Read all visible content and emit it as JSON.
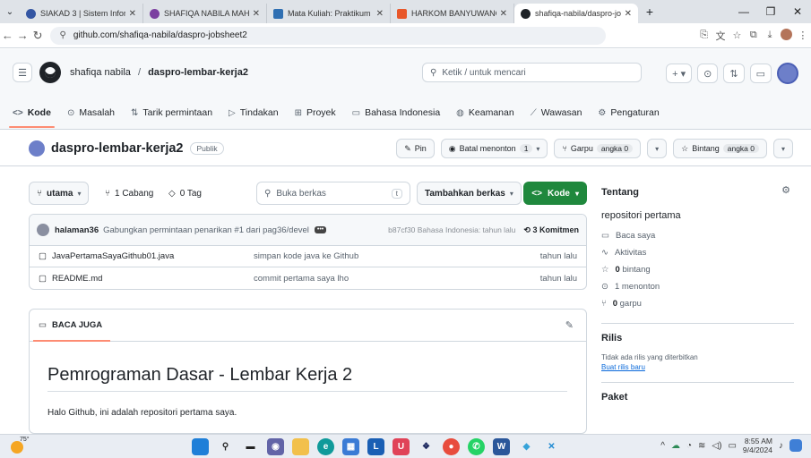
{
  "browser": {
    "tabs": [
      {
        "title": "SIAKAD 3 | Sistem Inform",
        "color": "#3456a3"
      },
      {
        "title": "SHAFIQA NABILA MAHA",
        "color": "#7b3fa0"
      },
      {
        "title": "Mata Kuliah: Praktikum D",
        "color": "#2f6fb2"
      },
      {
        "title": "HARKOM BANYUWANGI",
        "color": "#e8572a"
      },
      {
        "title": "shafiqa-nabila/daspro-jo",
        "color": "#1f2328"
      }
    ],
    "url": "github.com/shafiqa-nabila/daspro-jobsheet2",
    "new_tab": "+"
  },
  "header": {
    "owner": "shafiqa nabila",
    "separator": "/",
    "repo": "daspro-lembar-kerja2",
    "search_placeholder": "Ketik / untuk mencari"
  },
  "nav": [
    {
      "icon": "<>",
      "label": "Kode"
    },
    {
      "icon": "⊙",
      "label": "Masalah"
    },
    {
      "icon": "⇅",
      "label": "Tarik permintaan"
    },
    {
      "icon": "▷",
      "label": "Tindakan"
    },
    {
      "icon": "⊞",
      "label": "Proyek"
    },
    {
      "icon": "▭",
      "label": "Bahasa Indonesia"
    },
    {
      "icon": "◍",
      "label": "Keamanan"
    },
    {
      "icon": "⟋",
      "label": "Wawasan"
    },
    {
      "icon": "⚙",
      "label": "Pengaturan"
    }
  ],
  "repo": {
    "name": "daspro-lembar-kerja2",
    "visibility": "Publik",
    "pin": "Pin",
    "watch": "Batal menonton",
    "watch_count": "1",
    "fork": "Garpu",
    "fork_count": "angka 0",
    "star": "Bintang",
    "star_count": "angka 0"
  },
  "toolbar": {
    "branch": "utama",
    "branches": "1 Cabang",
    "tags": "0 Tag",
    "file_search": "Buka berkas",
    "file_search_key": "t",
    "add_file": "Tambahkan berkas",
    "code": "Kode"
  },
  "commit": {
    "user": "halaman36",
    "message": "Gabungkan permintaan penarikan #1 dari pag36/devel",
    "dots": "•••",
    "meta": "b87cf30 Bahasa Indonesia: tahun lalu",
    "count": "3 Komitmen"
  },
  "files": [
    {
      "name": "JavaPertamaSayaGithub01.java",
      "message": "simpan kode java ke Github",
      "time": "tahun lalu"
    },
    {
      "name": "README.md",
      "message": "commit pertama saya lho",
      "time": "tahun lalu"
    }
  ],
  "readme": {
    "tab": "BACA JUGA",
    "heading": "Pemrograman Dasar - Lembar Kerja 2",
    "paragraph": "Halo Github, ini adalah repositori pertama saya."
  },
  "sidebar": {
    "about_title": "Tentang",
    "description": "repositori pertama",
    "items": [
      {
        "icon": "▭",
        "text": "Baca saya",
        "bold": ""
      },
      {
        "icon": "∿",
        "text": "Aktivitas",
        "bold": ""
      },
      {
        "icon": "☆",
        "text": " bintang",
        "bold": "0"
      },
      {
        "icon": "⊙",
        "text": "1 menonton",
        "bold": ""
      },
      {
        "icon": "⑂",
        "text": " garpu",
        "bold": "0"
      }
    ],
    "releases_title": "Rilis",
    "releases_none": "Tidak ada rilis yang diterbitkan",
    "releases_create": "Buat rilis baru",
    "packages_title": "Paket"
  },
  "taskbar": {
    "temp": "75°",
    "time": "8:55 AM",
    "date": "9/4/2024"
  },
  "colors": {
    "accent_green": "#1f883d",
    "tab_underline": "#fd8c73",
    "link": "#0969da"
  }
}
